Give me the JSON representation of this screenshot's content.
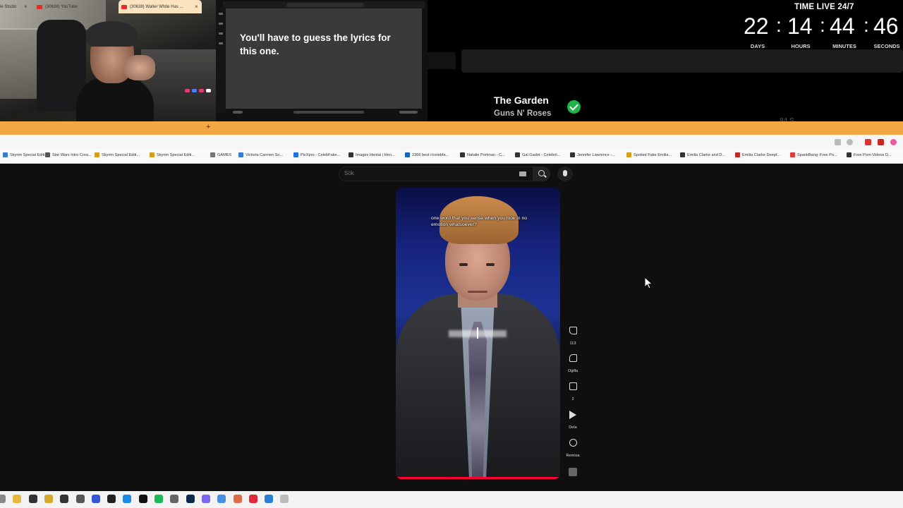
{
  "stream": {
    "chat_message": "You'll have to guess the lyrics for this one.",
    "now_playing": {
      "title": "The Garden",
      "artist": "Guns N' Roses"
    },
    "faint_label": "84 S...",
    "timer": {
      "title": "TIME LIVE 24/7",
      "days": "22",
      "hours": "14",
      "minutes": "44",
      "seconds": "46",
      "labels": {
        "days": "DAYS",
        "hours": "HOURS",
        "minutes": "MINUTES",
        "seconds": "SECONDS"
      }
    }
  },
  "browser": {
    "tabs": [
      {
        "label": "le Studio",
        "active": false
      },
      {
        "label": "(30638) YouTube",
        "active": false
      },
      {
        "label": "(30638) Walter White Has ...",
        "active": true
      }
    ],
    "new_tab": "+",
    "bookmarks": [
      "Skyrim Special Editi...",
      "Star Wars Intro Crea...",
      "Skyrim Special Editi...",
      "Skyrim Special Editi...",
      "GAMES",
      "Victoria Carmen So...",
      "PicXpro - CelebFake...",
      "Images Hentai | Hen...",
      "2366 best r/celebfa...",
      "Natalie Portman - C...",
      "Gal Gadot - Celebrit...",
      "Jennifer Lawrence -...",
      "Spoiled Fake Emilia...",
      "Emilia Clarke and D...",
      "Emilia Clarke Deepf...",
      "SpankBang: Free Po...",
      "Free Porn Videos D..."
    ]
  },
  "youtube": {
    "search_placeholder": "Sök",
    "caption_top": "one word that you sense when you look in no emotion whatsoever?",
    "actions": {
      "like_count": "113",
      "dislike_label": "Ogilla",
      "comment_count": "2",
      "share_label": "Dela",
      "remix_label": "Remixa"
    },
    "progress": 1.0
  },
  "colors": {
    "tab_strip": "#f2a742",
    "progress": "#ff0033",
    "check": "#1fb34a"
  }
}
